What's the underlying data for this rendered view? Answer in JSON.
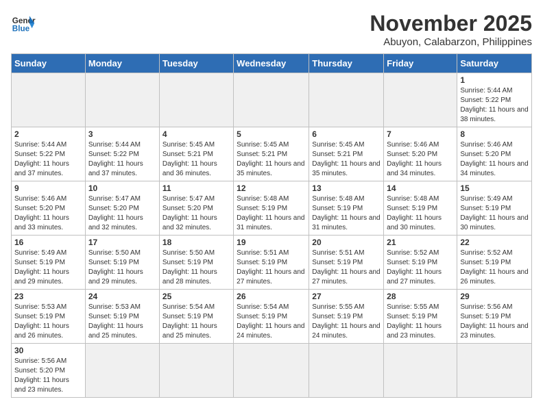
{
  "header": {
    "logo_text_general": "General",
    "logo_text_blue": "Blue",
    "month_title": "November 2025",
    "location": "Abuyon, Calabarzon, Philippines"
  },
  "weekdays": [
    "Sunday",
    "Monday",
    "Tuesday",
    "Wednesday",
    "Thursday",
    "Friday",
    "Saturday"
  ],
  "cells": [
    {
      "day": null,
      "sunrise": null,
      "sunset": null,
      "daylight": null
    },
    {
      "day": null,
      "sunrise": null,
      "sunset": null,
      "daylight": null
    },
    {
      "day": null,
      "sunrise": null,
      "sunset": null,
      "daylight": null
    },
    {
      "day": null,
      "sunrise": null,
      "sunset": null,
      "daylight": null
    },
    {
      "day": null,
      "sunrise": null,
      "sunset": null,
      "daylight": null
    },
    {
      "day": null,
      "sunrise": null,
      "sunset": null,
      "daylight": null
    },
    {
      "day": "1",
      "sunrise": "5:44 AM",
      "sunset": "5:22 PM",
      "daylight": "11 hours and 38 minutes."
    },
    {
      "day": "2",
      "sunrise": "5:44 AM",
      "sunset": "5:22 PM",
      "daylight": "11 hours and 37 minutes."
    },
    {
      "day": "3",
      "sunrise": "5:44 AM",
      "sunset": "5:22 PM",
      "daylight": "11 hours and 37 minutes."
    },
    {
      "day": "4",
      "sunrise": "5:45 AM",
      "sunset": "5:21 PM",
      "daylight": "11 hours and 36 minutes."
    },
    {
      "day": "5",
      "sunrise": "5:45 AM",
      "sunset": "5:21 PM",
      "daylight": "11 hours and 35 minutes."
    },
    {
      "day": "6",
      "sunrise": "5:45 AM",
      "sunset": "5:21 PM",
      "daylight": "11 hours and 35 minutes."
    },
    {
      "day": "7",
      "sunrise": "5:46 AM",
      "sunset": "5:20 PM",
      "daylight": "11 hours and 34 minutes."
    },
    {
      "day": "8",
      "sunrise": "5:46 AM",
      "sunset": "5:20 PM",
      "daylight": "11 hours and 34 minutes."
    },
    {
      "day": "9",
      "sunrise": "5:46 AM",
      "sunset": "5:20 PM",
      "daylight": "11 hours and 33 minutes."
    },
    {
      "day": "10",
      "sunrise": "5:47 AM",
      "sunset": "5:20 PM",
      "daylight": "11 hours and 32 minutes."
    },
    {
      "day": "11",
      "sunrise": "5:47 AM",
      "sunset": "5:20 PM",
      "daylight": "11 hours and 32 minutes."
    },
    {
      "day": "12",
      "sunrise": "5:48 AM",
      "sunset": "5:19 PM",
      "daylight": "11 hours and 31 minutes."
    },
    {
      "day": "13",
      "sunrise": "5:48 AM",
      "sunset": "5:19 PM",
      "daylight": "11 hours and 31 minutes."
    },
    {
      "day": "14",
      "sunrise": "5:48 AM",
      "sunset": "5:19 PM",
      "daylight": "11 hours and 30 minutes."
    },
    {
      "day": "15",
      "sunrise": "5:49 AM",
      "sunset": "5:19 PM",
      "daylight": "11 hours and 30 minutes."
    },
    {
      "day": "16",
      "sunrise": "5:49 AM",
      "sunset": "5:19 PM",
      "daylight": "11 hours and 29 minutes."
    },
    {
      "day": "17",
      "sunrise": "5:50 AM",
      "sunset": "5:19 PM",
      "daylight": "11 hours and 29 minutes."
    },
    {
      "day": "18",
      "sunrise": "5:50 AM",
      "sunset": "5:19 PM",
      "daylight": "11 hours and 28 minutes."
    },
    {
      "day": "19",
      "sunrise": "5:51 AM",
      "sunset": "5:19 PM",
      "daylight": "11 hours and 27 minutes."
    },
    {
      "day": "20",
      "sunrise": "5:51 AM",
      "sunset": "5:19 PM",
      "daylight": "11 hours and 27 minutes."
    },
    {
      "day": "21",
      "sunrise": "5:52 AM",
      "sunset": "5:19 PM",
      "daylight": "11 hours and 27 minutes."
    },
    {
      "day": "22",
      "sunrise": "5:52 AM",
      "sunset": "5:19 PM",
      "daylight": "11 hours and 26 minutes."
    },
    {
      "day": "23",
      "sunrise": "5:53 AM",
      "sunset": "5:19 PM",
      "daylight": "11 hours and 26 minutes."
    },
    {
      "day": "24",
      "sunrise": "5:53 AM",
      "sunset": "5:19 PM",
      "daylight": "11 hours and 25 minutes."
    },
    {
      "day": "25",
      "sunrise": "5:54 AM",
      "sunset": "5:19 PM",
      "daylight": "11 hours and 25 minutes."
    },
    {
      "day": "26",
      "sunrise": "5:54 AM",
      "sunset": "5:19 PM",
      "daylight": "11 hours and 24 minutes."
    },
    {
      "day": "27",
      "sunrise": "5:55 AM",
      "sunset": "5:19 PM",
      "daylight": "11 hours and 24 minutes."
    },
    {
      "day": "28",
      "sunrise": "5:55 AM",
      "sunset": "5:19 PM",
      "daylight": "11 hours and 23 minutes."
    },
    {
      "day": "29",
      "sunrise": "5:56 AM",
      "sunset": "5:19 PM",
      "daylight": "11 hours and 23 minutes."
    },
    {
      "day": "30",
      "sunrise": "5:56 AM",
      "sunset": "5:20 PM",
      "daylight": "11 hours and 23 minutes."
    },
    {
      "day": null,
      "sunrise": null,
      "sunset": null,
      "daylight": null
    },
    {
      "day": null,
      "sunrise": null,
      "sunset": null,
      "daylight": null
    },
    {
      "day": null,
      "sunrise": null,
      "sunset": null,
      "daylight": null
    },
    {
      "day": null,
      "sunrise": null,
      "sunset": null,
      "daylight": null
    },
    {
      "day": null,
      "sunrise": null,
      "sunset": null,
      "daylight": null
    },
    {
      "day": null,
      "sunrise": null,
      "sunset": null,
      "daylight": null
    }
  ]
}
